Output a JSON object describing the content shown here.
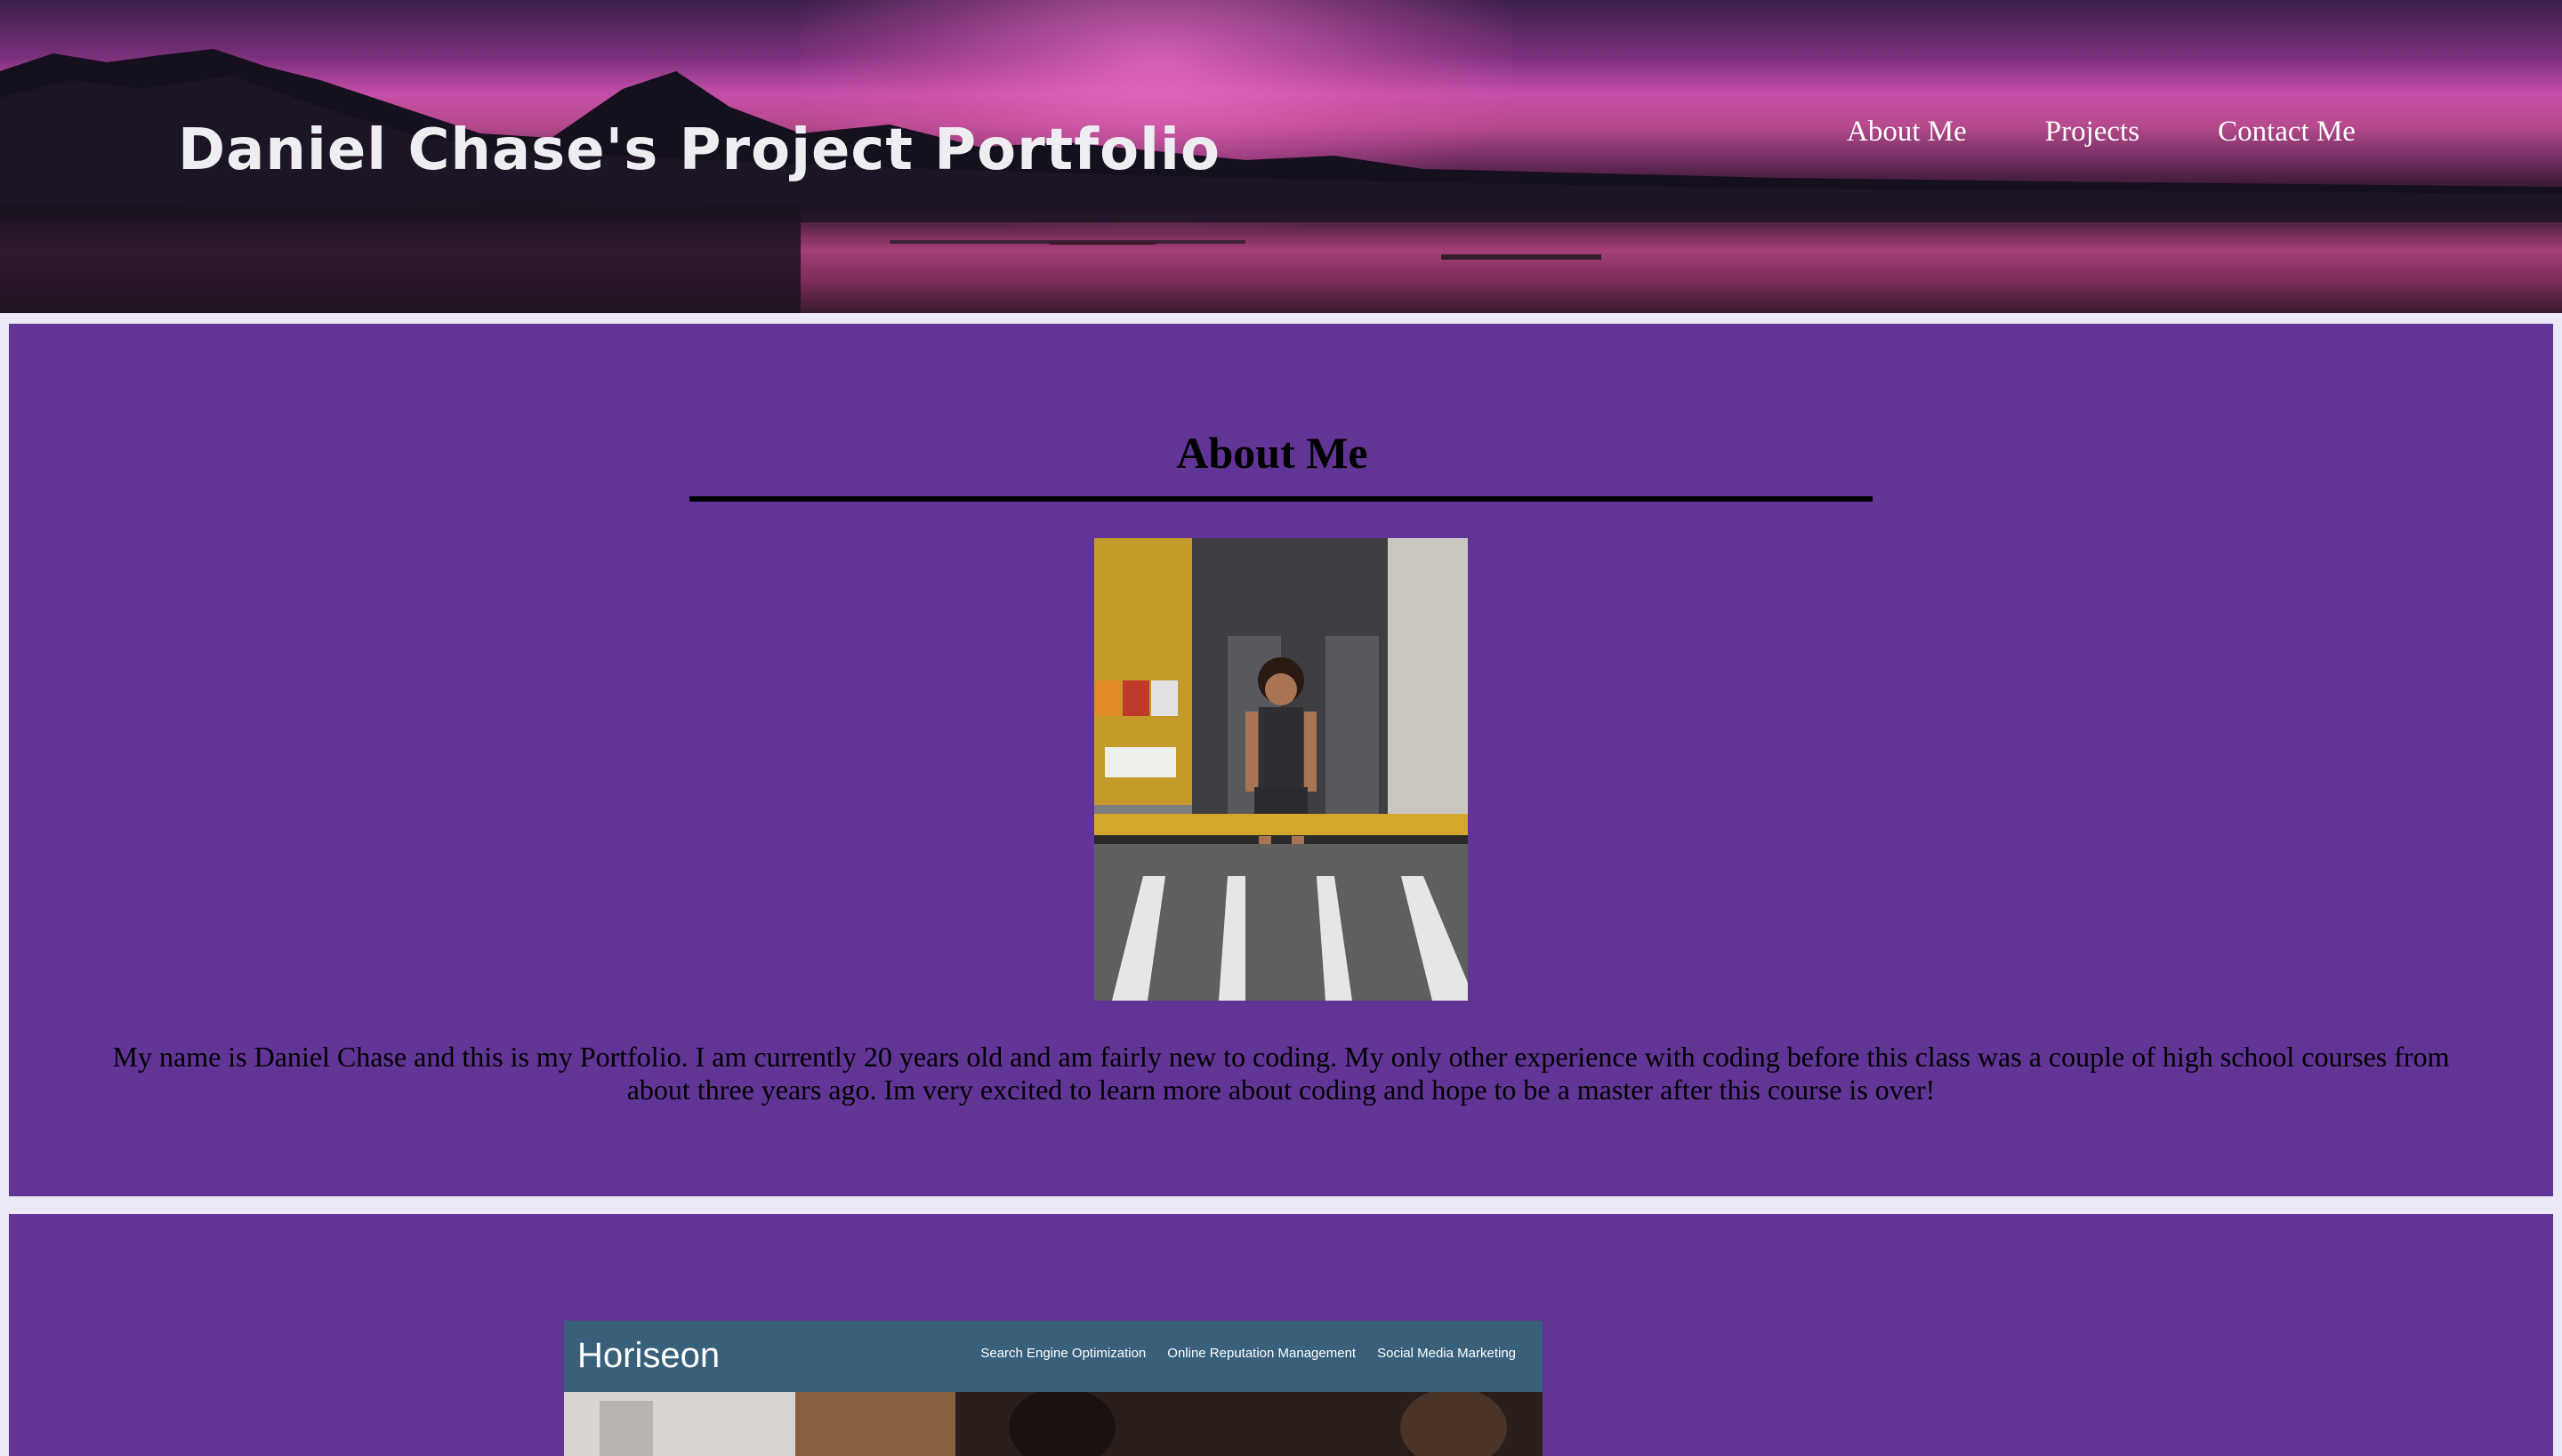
{
  "header": {
    "title": "Daniel Chase's Project Portfolio",
    "nav": [
      "About Me",
      "Projects",
      "Contact Me"
    ]
  },
  "about": {
    "heading": "About Me",
    "photo_alt": "Portrait photo of Daniel Chase sitting at the open back door of a yellow school bus",
    "text": "My name is Daniel Chase and this is my Portfolio. I am currently 20 years old and am fairly new to coding. My only other experience with coding before this class was a couple of high school courses from about three years ago. Im very excited to learn more about coding and hope to be a master after this course is over!"
  },
  "projects": {
    "items": [
      {
        "logo": "Horiseon",
        "nav": [
          "Search Engine Optimization",
          "Online Reputation Management",
          "Social Media Marketing"
        ]
      }
    ]
  },
  "colors": {
    "panel": "#613596",
    "page_background": "#ece8f6",
    "project_header": "#38607a"
  }
}
